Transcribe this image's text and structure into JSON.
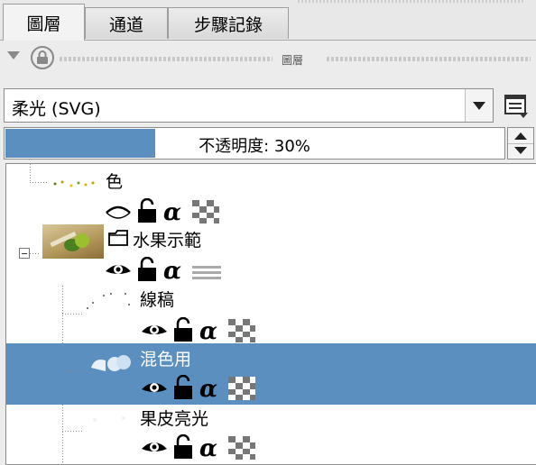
{
  "tabs": [
    {
      "label": "圖層",
      "active": true
    },
    {
      "label": "通道",
      "active": false
    },
    {
      "label": "步驟記錄",
      "active": false
    }
  ],
  "panel": {
    "title": "圖層"
  },
  "blend_mode": {
    "value": "柔光 (SVG)"
  },
  "opacity": {
    "label": "不透明度: 30%",
    "value_percent": 30
  },
  "layers": [
    {
      "name": "色",
      "selected": false,
      "visible": false
    },
    {
      "name": "水果示範",
      "selected": false,
      "visible": true,
      "group": true
    },
    {
      "name": "線稿",
      "selected": false,
      "visible": true
    },
    {
      "name": "混色用",
      "selected": true,
      "visible": true
    },
    {
      "name": "果皮亮光",
      "selected": false,
      "visible": true
    }
  ],
  "colors": {
    "selection": "#5b8fbf",
    "opacity_fill": "#5b8fbf"
  }
}
